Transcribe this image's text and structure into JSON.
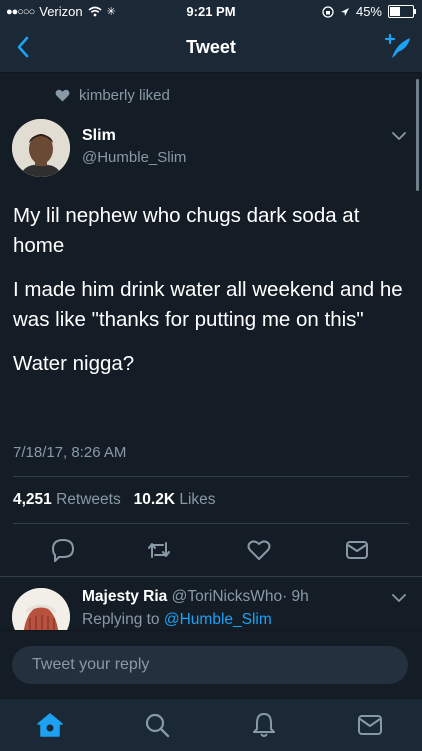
{
  "status_bar": {
    "carrier": "Verizon",
    "time": "9:21 PM",
    "battery": "45%",
    "battery_level": 0.45
  },
  "nav": {
    "title": "Tweet",
    "back_icon": "chevron-left-icon",
    "compose_icon": "compose-tweet-icon"
  },
  "tweet": {
    "social_context": "kimberly liked",
    "author_name": "Slim",
    "author_handle": "@Humble_Slim",
    "paragraphs": [
      "My lil nephew who chugs dark soda at home",
      "I made him drink water all weekend and he was like \"thanks for putting me on this\"",
      "Water nigga?"
    ],
    "timestamp": "7/18/17, 8:26 AM",
    "retweets_count": "4,251",
    "retweets_label": "Retweets",
    "likes_count": "10.2K",
    "likes_label": "Likes"
  },
  "reply": {
    "author_name": "Majesty Ria",
    "author_handle": "@ToriNicksWho",
    "time": "· 9h",
    "replying_label": "Replying to",
    "replying_to": "@Humble_Slim"
  },
  "reply_box": {
    "placeholder": "Tweet your reply"
  },
  "tab_bar": {
    "icons": [
      "home-icon",
      "search-icon",
      "notifications-icon",
      "messages-icon"
    ]
  },
  "colors": {
    "background": "#141d26",
    "bar": "#1b2836",
    "accent": "#1da1f2",
    "muted": "#8899a6"
  }
}
